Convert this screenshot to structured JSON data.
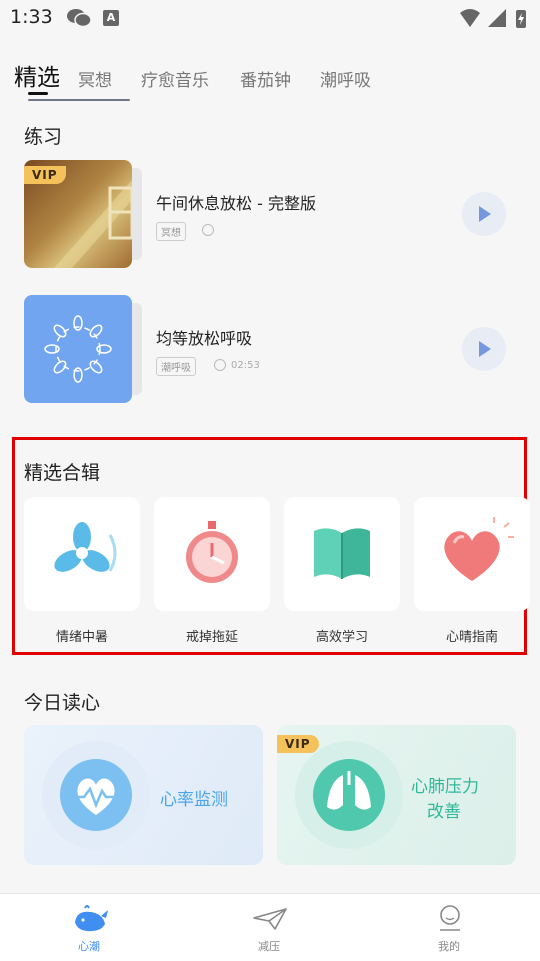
{
  "status": {
    "time": "1:33",
    "a_icon": "A"
  },
  "tabs": [
    {
      "label": "精选",
      "active": true
    },
    {
      "label": "冥想"
    },
    {
      "label": "疗愈音乐"
    },
    {
      "label": "番茄钟"
    },
    {
      "label": "潮呼吸"
    }
  ],
  "practice": {
    "title": "练习",
    "items": [
      {
        "title": "午间休息放松 - 完整版",
        "tag": "冥想",
        "vip": "VIP",
        "duration": ""
      },
      {
        "title": "均等放松呼吸",
        "tag": "潮呼吸",
        "duration": "02:53"
      }
    ]
  },
  "collection": {
    "title": "精选合辑",
    "items": [
      {
        "label": "情绪中暑",
        "icon": "fan-icon"
      },
      {
        "label": "戒掉拖延",
        "icon": "stopwatch-icon"
      },
      {
        "label": "高效学习",
        "icon": "book-icon"
      },
      {
        "label": "心晴指南",
        "icon": "heart-icon"
      }
    ]
  },
  "reading": {
    "title": "今日读心",
    "cards": [
      {
        "text": "心率监测",
        "icon": "heart-rate-icon"
      },
      {
        "text_line1": "心肺压力",
        "text_line2": "改善",
        "icon": "lungs-icon",
        "vip": "VIP"
      }
    ]
  },
  "nav": [
    {
      "label": "心潮",
      "active": true,
      "icon": "whale-icon"
    },
    {
      "label": "减压",
      "icon": "paper-plane-icon"
    },
    {
      "label": "我的",
      "icon": "profile-icon"
    }
  ],
  "colors": {
    "accent": "#3f8ef0",
    "highlight": "#e00000",
    "vip": "#f5c15b"
  }
}
